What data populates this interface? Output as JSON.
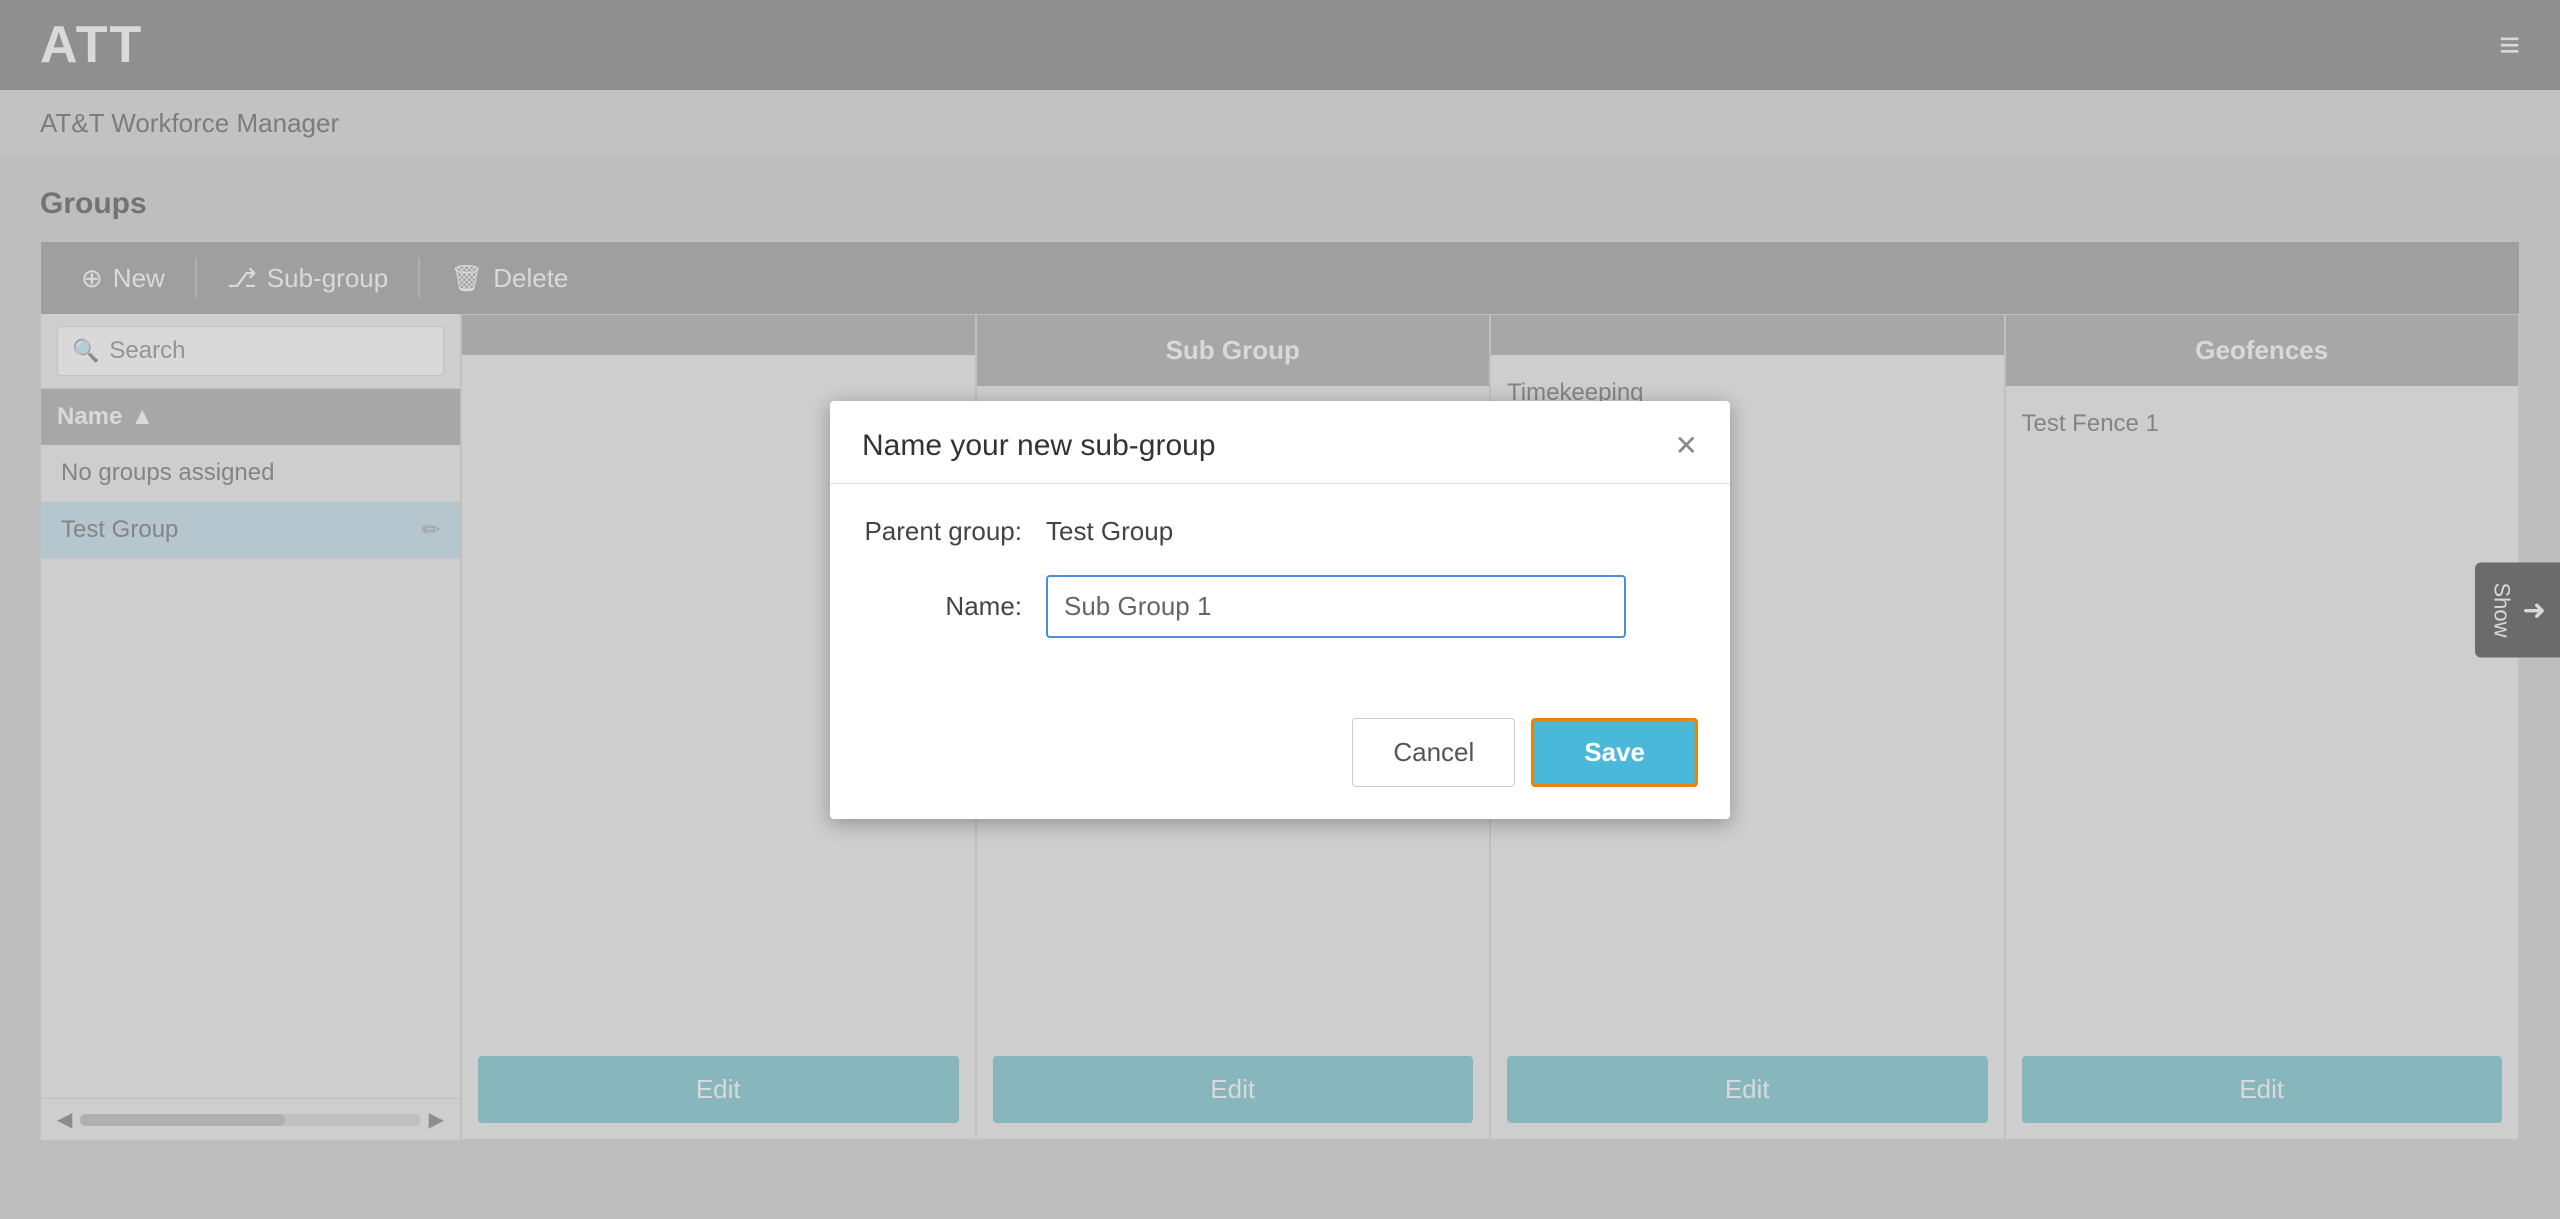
{
  "header": {
    "app_title": "ATT",
    "subtitle": "AT&T Workforce Manager",
    "hamburger_symbol": "≡"
  },
  "page": {
    "title": "Groups"
  },
  "toolbar": {
    "new_label": "New",
    "subgroup_label": "Sub-group",
    "delete_label": "Delete",
    "new_icon": "⊕",
    "subgroup_icon": "⎇",
    "delete_icon": "🗑"
  },
  "groups_list": {
    "search_placeholder": "Search",
    "column_name": "Name",
    "rows": [
      {
        "name": "No groups assigned",
        "selected": false
      },
      {
        "name": "Test Group",
        "selected": true
      }
    ]
  },
  "cards": [
    {
      "header": "",
      "items": [],
      "edit_label": "Edit"
    },
    {
      "header": "Sub Group",
      "items": [],
      "edit_label": "Edit"
    },
    {
      "header": "",
      "items": [
        "Timekeeping"
      ],
      "edit_label": "Edit"
    },
    {
      "header": "Geofences",
      "items": [
        "Test Fence 1"
      ],
      "edit_label": "Edit"
    }
  ],
  "show_panel": {
    "label": "Show",
    "arrow": "❶"
  },
  "modal": {
    "title": "Name your new sub-group",
    "close_symbol": "✕",
    "parent_group_label": "Parent group:",
    "parent_group_value": "Test Group",
    "name_label": "Name:",
    "name_value": "Sub Group 1",
    "name_placeholder": "Sub Group 1",
    "cancel_label": "Cancel",
    "save_label": "Save"
  }
}
